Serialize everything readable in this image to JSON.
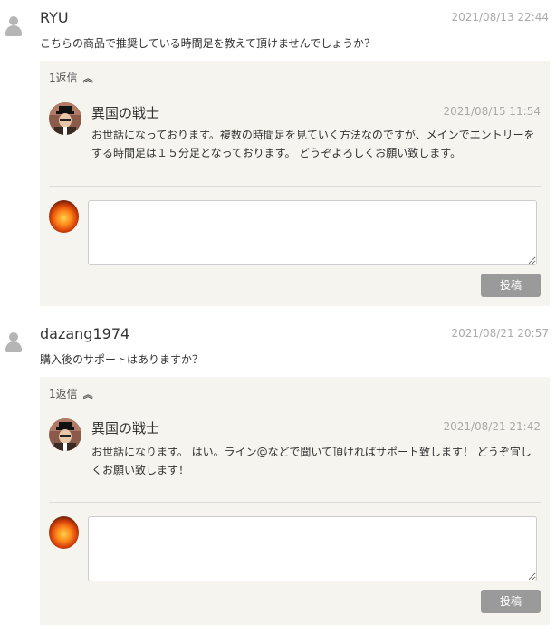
{
  "comments": [
    {
      "author": "RYU",
      "date": "2021/08/13 22:44",
      "text": "こちらの商品で推奨している時間足を教えて頂けませんでしょうか？",
      "reply_count": "1返信",
      "reply": {
        "author": "異国の戦士",
        "date": "2021/08/15 11:54",
        "text": "お世話になっております。複数の時間足を見ていく方法なのですが、メインでエントリーをする時間足は１５分足となっております。 どうぞよろしくお願い致します。"
      },
      "post_label": "投稿"
    },
    {
      "author": "dazang1974",
      "date": "2021/08/21 20:57",
      "text": "購入後のサポートはありますか？",
      "reply_count": "1返信",
      "reply": {
        "author": "異国の戦士",
        "date": "2021/08/21 21:42",
        "text": "お世話になります。 はい。ライン@などで聞いて頂ければサポート致します！ どうぞ宜しくお願い致します！"
      },
      "post_label": "投稿"
    }
  ],
  "icons": {
    "default_avatar": "user-silhouette-icon",
    "reply_avatar": "man-with-hat-avatar",
    "current_user_avatar": "fire-avatar",
    "collapse": "chevron-double-up-icon"
  }
}
